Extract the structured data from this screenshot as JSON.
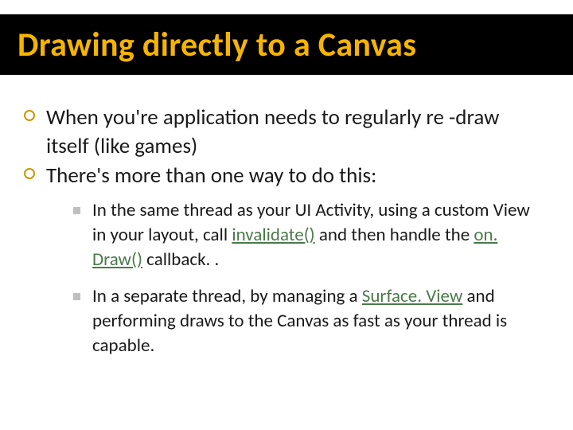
{
  "title": "Drawing directly to a Canvas",
  "bullets": {
    "b1": "When you're application needs to regularly re -draw itself (like games)",
    "b2": "There's more than one way to do this:",
    "sub1_a": "In the same thread as your UI Activity, using a custom View in your layout, call ",
    "sub1_link1": "invalidate()",
    "sub1_b": " and then handle the ",
    "sub1_link2": "on. Draw()",
    "sub1_c": " callback. .",
    "sub2_a": "In a separate thread, by managing a ",
    "sub2_link1": "Surface. View",
    "sub2_b": " and performing draws to the Canvas as fast as your thread is capable."
  }
}
